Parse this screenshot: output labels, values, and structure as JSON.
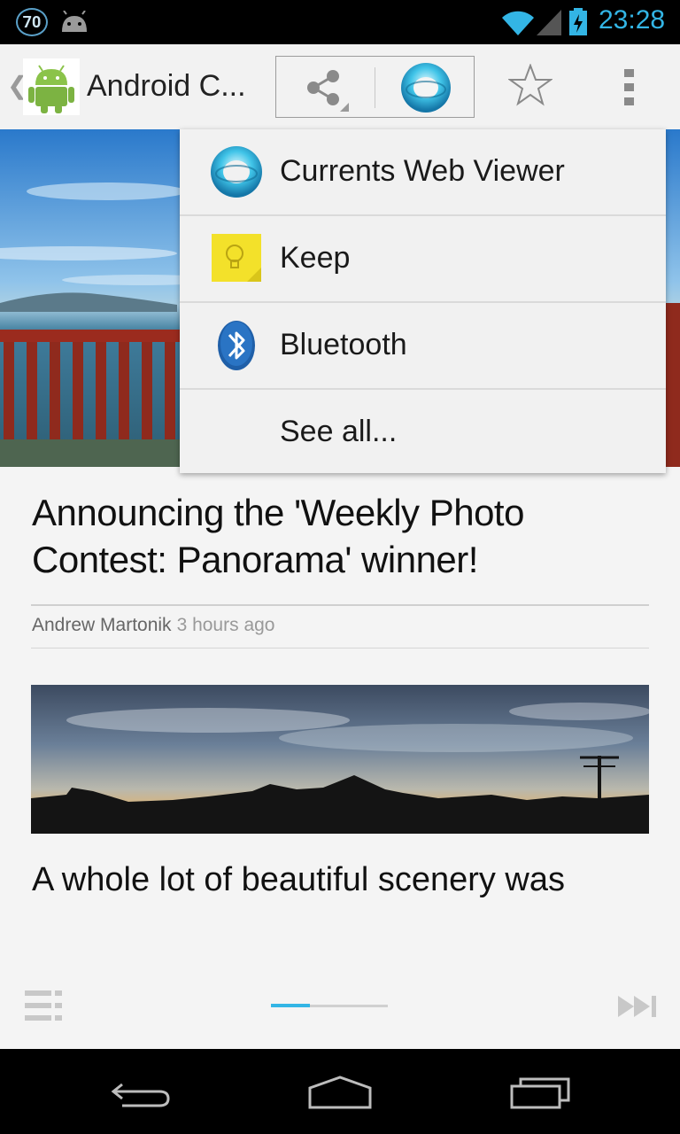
{
  "status_bar": {
    "notification_count": "70",
    "time": "23:28"
  },
  "app_bar": {
    "title": "Android C...",
    "up_caret": "❮"
  },
  "share_menu": {
    "items": [
      {
        "label": "Currents Web Viewer",
        "icon": "currents-icon"
      },
      {
        "label": "Keep",
        "icon": "keep-icon"
      },
      {
        "label": "Bluetooth",
        "icon": "bluetooth-icon"
      },
      {
        "label": "See all...",
        "icon": ""
      }
    ]
  },
  "article": {
    "title": "Announcing the 'Weekly Photo Contest: Panorama' winner!",
    "author": "Andrew Martonik",
    "time": "3 hours ago",
    "lead": "A whole lot of beautiful scenery was"
  },
  "pager": {
    "progress": 0.33
  },
  "colors": {
    "accent": "#33b5e5",
    "appbar_bg": "#f2f2f2",
    "content_bg": "#f4f4f4"
  }
}
